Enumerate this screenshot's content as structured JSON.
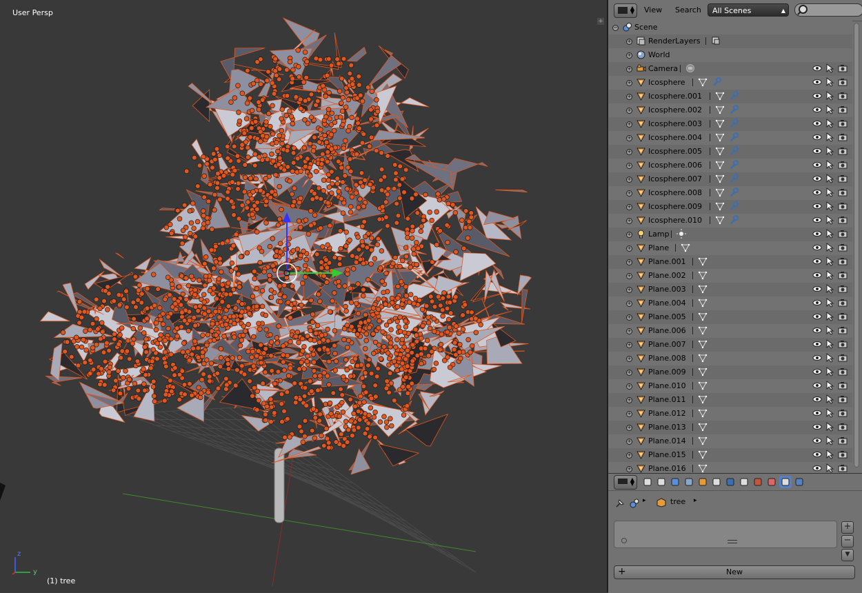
{
  "viewport": {
    "view_label": "User Persp",
    "object_label": "(1) tree",
    "axis_z": "z",
    "axis_y": "y"
  },
  "outliner": {
    "menu_view": "View",
    "menu_search": "Search",
    "scene_select": "All Scenes",
    "rows": [
      {
        "name": "Scene",
        "icon": "scene-icon",
        "depth": 0
      },
      {
        "name": "RenderLayers",
        "icon": "render-layers-icon",
        "depth": 1,
        "sub": [
          "render-layer-icon"
        ]
      },
      {
        "name": "World",
        "icon": "world-icon",
        "depth": 1
      },
      {
        "name": "Camera",
        "icon": "camera-icon",
        "depth": 1,
        "sub": [
          "camera-data-icon"
        ],
        "vis": true
      },
      {
        "name": "Icosphere",
        "icon": "mesh-object-icon",
        "depth": 1,
        "sub": [
          "mesh-data-icon",
          "wrench-icon"
        ],
        "vis": true
      },
      {
        "name": "Icosphere.001",
        "icon": "mesh-object-icon",
        "depth": 1,
        "sub": [
          "mesh-data-icon",
          "wrench-icon"
        ],
        "vis": true
      },
      {
        "name": "Icosphere.002",
        "icon": "mesh-object-icon",
        "depth": 1,
        "sub": [
          "mesh-data-icon",
          "wrench-icon"
        ],
        "vis": true
      },
      {
        "name": "Icosphere.003",
        "icon": "mesh-object-icon",
        "depth": 1,
        "sub": [
          "mesh-data-icon",
          "wrench-icon"
        ],
        "vis": true
      },
      {
        "name": "Icosphere.004",
        "icon": "mesh-object-icon",
        "depth": 1,
        "sub": [
          "mesh-data-icon",
          "wrench-icon"
        ],
        "vis": true
      },
      {
        "name": "Icosphere.005",
        "icon": "mesh-object-icon",
        "depth": 1,
        "sub": [
          "mesh-data-icon",
          "wrench-icon"
        ],
        "vis": true
      },
      {
        "name": "Icosphere.006",
        "icon": "mesh-object-icon",
        "depth": 1,
        "sub": [
          "mesh-data-icon",
          "wrench-icon"
        ],
        "vis": true
      },
      {
        "name": "Icosphere.007",
        "icon": "mesh-object-icon",
        "depth": 1,
        "sub": [
          "mesh-data-icon",
          "wrench-icon"
        ],
        "vis": true
      },
      {
        "name": "Icosphere.008",
        "icon": "mesh-object-icon",
        "depth": 1,
        "sub": [
          "mesh-data-icon",
          "wrench-icon"
        ],
        "vis": true
      },
      {
        "name": "Icosphere.009",
        "icon": "mesh-object-icon",
        "depth": 1,
        "sub": [
          "mesh-data-icon",
          "wrench-icon"
        ],
        "vis": true
      },
      {
        "name": "Icosphere.010",
        "icon": "mesh-object-icon",
        "depth": 1,
        "sub": [
          "mesh-data-icon",
          "wrench-icon"
        ],
        "vis": true
      },
      {
        "name": "Lamp",
        "icon": "lamp-icon",
        "depth": 1,
        "sub": [
          "lamp-data-icon"
        ],
        "vis": true
      },
      {
        "name": "Plane",
        "icon": "mesh-object-icon",
        "depth": 1,
        "sub": [
          "mesh-data-icon"
        ],
        "vis": true
      },
      {
        "name": "Plane.001",
        "icon": "mesh-object-icon",
        "depth": 1,
        "sub": [
          "mesh-data-icon"
        ],
        "vis": true
      },
      {
        "name": "Plane.002",
        "icon": "mesh-object-icon",
        "depth": 1,
        "sub": [
          "mesh-data-icon"
        ],
        "vis": true
      },
      {
        "name": "Plane.003",
        "icon": "mesh-object-icon",
        "depth": 1,
        "sub": [
          "mesh-data-icon"
        ],
        "vis": true
      },
      {
        "name": "Plane.004",
        "icon": "mesh-object-icon",
        "depth": 1,
        "sub": [
          "mesh-data-icon"
        ],
        "vis": true
      },
      {
        "name": "Plane.005",
        "icon": "mesh-object-icon",
        "depth": 1,
        "sub": [
          "mesh-data-icon"
        ],
        "vis": true
      },
      {
        "name": "Plane.006",
        "icon": "mesh-object-icon",
        "depth": 1,
        "sub": [
          "mesh-data-icon"
        ],
        "vis": true
      },
      {
        "name": "Plane.007",
        "icon": "mesh-object-icon",
        "depth": 1,
        "sub": [
          "mesh-data-icon"
        ],
        "vis": true
      },
      {
        "name": "Plane.008",
        "icon": "mesh-object-icon",
        "depth": 1,
        "sub": [
          "mesh-data-icon"
        ],
        "vis": true
      },
      {
        "name": "Plane.009",
        "icon": "mesh-object-icon",
        "depth": 1,
        "sub": [
          "mesh-data-icon"
        ],
        "vis": true
      },
      {
        "name": "Plane.010",
        "icon": "mesh-object-icon",
        "depth": 1,
        "sub": [
          "mesh-data-icon"
        ],
        "vis": true
      },
      {
        "name": "Plane.011",
        "icon": "mesh-object-icon",
        "depth": 1,
        "sub": [
          "mesh-data-icon"
        ],
        "vis": true
      },
      {
        "name": "Plane.012",
        "icon": "mesh-object-icon",
        "depth": 1,
        "sub": [
          "mesh-data-icon"
        ],
        "vis": true
      },
      {
        "name": "Plane.013",
        "icon": "mesh-object-icon",
        "depth": 1,
        "sub": [
          "mesh-data-icon"
        ],
        "vis": true
      },
      {
        "name": "Plane.014",
        "icon": "mesh-object-icon",
        "depth": 1,
        "sub": [
          "mesh-data-icon"
        ],
        "vis": true
      },
      {
        "name": "Plane.015",
        "icon": "mesh-object-icon",
        "depth": 1,
        "sub": [
          "mesh-data-icon"
        ],
        "vis": true
      },
      {
        "name": "Plane.016",
        "icon": "mesh-object-icon",
        "depth": 1,
        "sub": [
          "mesh-data-icon"
        ],
        "vis": true
      }
    ]
  },
  "properties": {
    "tabs": [
      "render-icon",
      "render-layers-icon",
      "scene-icon",
      "world-icon",
      "object-icon",
      "constraints-icon",
      "modifiers-icon",
      "data-icon",
      "material-icon",
      "texture-icon",
      "particles-icon",
      "physics-icon"
    ],
    "active_tab": "particles-icon",
    "breadcrumb_object": "tree",
    "new_button": "New"
  },
  "colors": {
    "selection_orange": "#e2571e",
    "viewport_bg": "#393939",
    "panel_bg": "#727272",
    "active_tab": "#5680c2"
  }
}
